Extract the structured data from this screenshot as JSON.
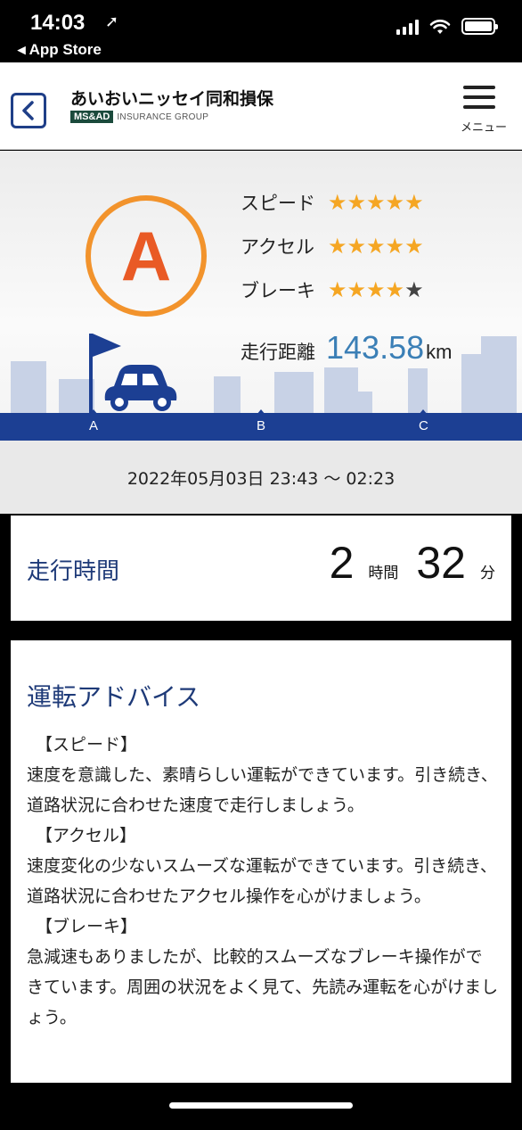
{
  "status_bar": {
    "time": "14:03",
    "back_app": "◂ App Store"
  },
  "nav": {
    "back_label": "<",
    "brand_name": "あいおいニッセイ同和損保",
    "brand_logo": "MS&AD",
    "brand_group": "INSURANCE GROUP",
    "menu_label": "メニュー"
  },
  "score": {
    "grade": "A",
    "ratings": [
      {
        "label": "スピード",
        "stars": 5,
        "max": 5
      },
      {
        "label": "アクセル",
        "stars": 5,
        "max": 5
      },
      {
        "label": "ブレーキ",
        "stars": 4,
        "max": 5
      }
    ],
    "distance_label": "走行距離",
    "distance_value": "143.58",
    "distance_unit": "km",
    "road_points": [
      "A",
      "B",
      "C"
    ]
  },
  "date_range": "2022年05月03日 23:43 〜 02:23",
  "drive_time": {
    "label": "走行時間",
    "hours": "2",
    "hours_unit": "時間",
    "minutes": "32",
    "minutes_unit": "分"
  },
  "advice": {
    "title": "運転アドバイス",
    "sections": [
      {
        "heading": "【スピード】",
        "text": "速度を意識した、素晴らしい運転ができています。引き続き、道路状況に合わせた速度で走行しましょう。"
      },
      {
        "heading": "【アクセル】",
        "text": "速度変化の少ないスムーズな運転ができています。引き続き、道路状況に合わせたアクセル操作を心がけましょう。"
      },
      {
        "heading": "【ブレーキ】",
        "text": "急減速もありましたが、比較的スムーズなブレーキ操作ができています。周囲の状況をよく見て、先読み運転を心がけましょう。"
      }
    ]
  },
  "colors": {
    "brand_navy": "#1c3f93",
    "grade_orange": "#e95a25",
    "star_on": "#f5a623",
    "star_off": "#444444",
    "distance_blue": "#3b7fb6"
  },
  "icons": [
    "location-arrow-icon",
    "signal-icon",
    "wifi-icon",
    "battery-icon",
    "back-chevron-icon",
    "hamburger-menu-icon",
    "flag-icon",
    "car-icon",
    "star-icon"
  ]
}
